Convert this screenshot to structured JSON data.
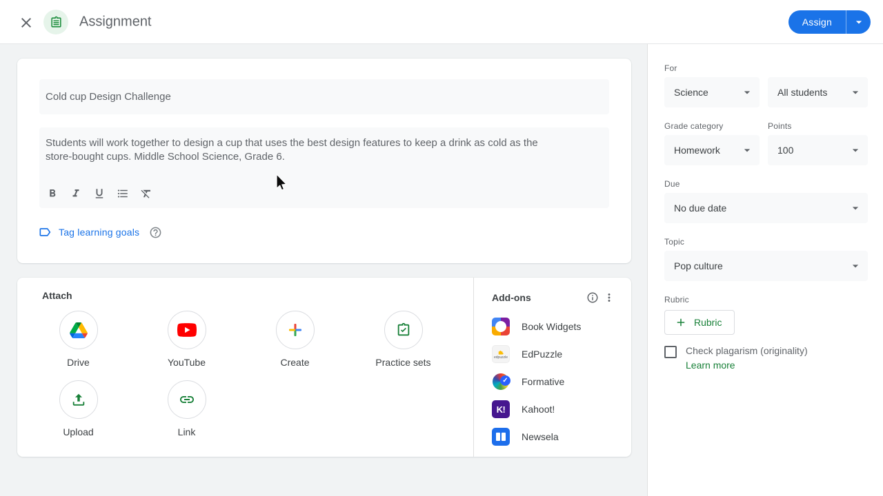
{
  "header": {
    "title": "Assignment",
    "assign_label": "Assign"
  },
  "form": {
    "title_value": "Cold cup Design Challenge",
    "description_value": "Students will work together to design a cup that uses the best design features to keep a drink as cold as the store-bought cups. Middle School Science, Grade 6.",
    "toolbar": [
      "bold",
      "italic",
      "underline",
      "bulleted-list",
      "clear-formatting"
    ],
    "tag_learning_goals_label": "Tag learning goals"
  },
  "attach": {
    "title": "Attach",
    "items": [
      {
        "label": "Drive",
        "icon": "google-drive-icon"
      },
      {
        "label": "YouTube",
        "icon": "youtube-icon"
      },
      {
        "label": "Create",
        "icon": "create-plus-icon"
      },
      {
        "label": "Practice sets",
        "icon": "practice-sets-icon"
      },
      {
        "label": "Upload",
        "icon": "upload-icon"
      },
      {
        "label": "Link",
        "icon": "link-icon"
      }
    ]
  },
  "addons": {
    "title": "Add-ons",
    "items": [
      {
        "label": "Book Widgets",
        "icon": "book-widgets-icon"
      },
      {
        "label": "EdPuzzle",
        "icon": "edpuzzle-icon",
        "icon_text": "edpuzzle"
      },
      {
        "label": "Formative",
        "icon": "formative-icon"
      },
      {
        "label": "Kahoot!",
        "icon": "kahoot-icon",
        "icon_text": "K!"
      },
      {
        "label": "Newsela",
        "icon": "newsela-icon"
      }
    ]
  },
  "sidebar": {
    "for_label": "For",
    "class_value": "Science",
    "students_value": "All students",
    "grade_category_label": "Grade category",
    "grade_category_value": "Homework",
    "points_label": "Points",
    "points_value": "100",
    "due_label": "Due",
    "due_value": "No due date",
    "topic_label": "Topic",
    "topic_value": "Pop culture",
    "rubric_label": "Rubric",
    "rubric_button_label": "Rubric",
    "plagiarism_label": "Check plagarism (originality)",
    "learn_more_label": "Learn more"
  },
  "colors": {
    "accent_blue": "#1a73e8",
    "action_green": "#188038",
    "assignment_icon_green": "#1e8e3e",
    "background_gray": "#f1f3f4",
    "field_gray": "#f8f9fa",
    "text_gray": "#5f6368",
    "text_dark": "#3c4043",
    "youtube_red": "#ff0000",
    "kahoot_purple": "#46178f",
    "newsela_blue": "#1d6eeb"
  }
}
